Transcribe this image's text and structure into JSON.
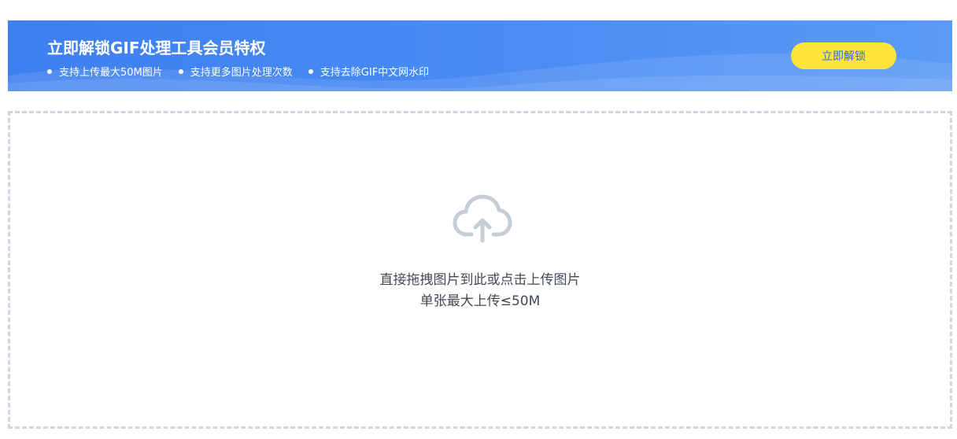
{
  "banner": {
    "title": "立即解锁GIF处理工具会员特权",
    "benefits": [
      "支持上传最大50M图片",
      "支持更多图片处理次数",
      "支持去除GIF中文网水印"
    ],
    "unlock_button": "立即解锁"
  },
  "upload": {
    "icon": "cloud-upload-icon",
    "instruction": "直接拖拽图片到此或点击上传图片",
    "size_limit": "单张最大上传≤50M"
  },
  "colors": {
    "banner_blue": "#3d7ff0",
    "button_yellow": "#ffe43a",
    "button_text": "#2f6fd6",
    "dashed_border": "#cfd6de",
    "icon_gray": "#c5ced7"
  }
}
